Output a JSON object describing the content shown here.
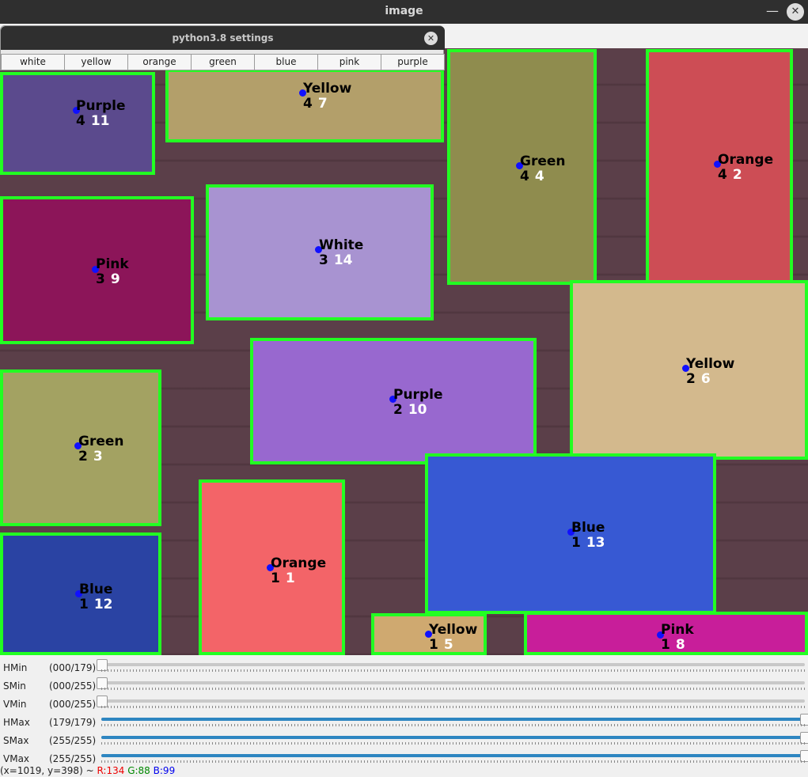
{
  "window": {
    "title": "image"
  },
  "settings": {
    "title": "python3.8 settings",
    "buttons": [
      "white",
      "yellow",
      "orange",
      "green",
      "blue",
      "pink",
      "purple"
    ]
  },
  "cards": [
    {
      "name": "Purple",
      "a": "4",
      "b": "11",
      "color": "#5b4a8d"
    },
    {
      "name": "Yellow",
      "a": "4",
      "b": "7",
      "color": "#b39f6a"
    },
    {
      "name": "Green",
      "a": "4",
      "b": "4",
      "color": "#8f8c4e"
    },
    {
      "name": "Orange",
      "a": "4",
      "b": "2",
      "color": "#cd4d55"
    },
    {
      "name": "Pink",
      "a": "3",
      "b": "9",
      "color": "#8c1559"
    },
    {
      "name": "White",
      "a": "3",
      "b": "14",
      "color": "#a893d1"
    },
    {
      "name": "Yellow",
      "a": "2",
      "b": "6",
      "color": "#d3b98d"
    },
    {
      "name": "Purple",
      "a": "2",
      "b": "10",
      "color": "#9868cf"
    },
    {
      "name": "Green",
      "a": "2",
      "b": "3",
      "color": "#a3a262"
    },
    {
      "name": "Blue",
      "a": "1",
      "b": "13",
      "color": "#3759d3"
    },
    {
      "name": "Orange",
      "a": "1",
      "b": "1",
      "color": "#f36468"
    },
    {
      "name": "Blue",
      "a": "1",
      "b": "12",
      "color": "#2a43a3"
    },
    {
      "name": "Yellow",
      "a": "1",
      "b": "5",
      "color": "#cfa970"
    },
    {
      "name": "Pink",
      "a": "1",
      "b": "8",
      "color": "#c81e9a"
    }
  ],
  "sliders": [
    {
      "name": "HMin",
      "value": "(000/179)",
      "level": 0
    },
    {
      "name": "SMin",
      "value": "(000/255)",
      "level": 0
    },
    {
      "name": "VMin",
      "value": "(000/255)",
      "level": 0
    },
    {
      "name": "HMax",
      "value": "(179/179)",
      "level": 1
    },
    {
      "name": "SMax",
      "value": "(255/255)",
      "level": 1
    },
    {
      "name": "VMax",
      "value": "(255/255)",
      "level": 1
    }
  ],
  "status": {
    "coords": "(x=1019, y=398) ~",
    "r": "R:134",
    "g": "G:88",
    "b": "B:99"
  }
}
